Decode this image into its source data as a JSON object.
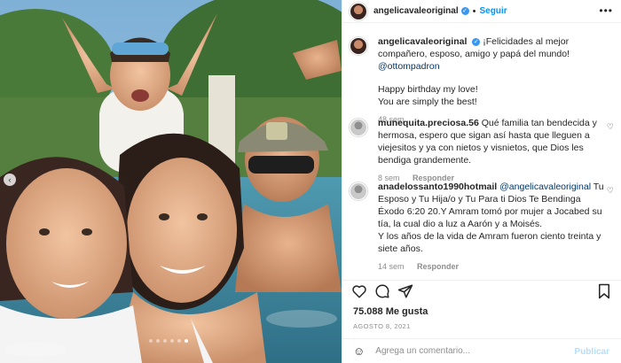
{
  "header": {
    "username": "angelicavaleoriginal",
    "separator": "•",
    "follow_label": "Seguir",
    "more_label": "•••"
  },
  "caption": {
    "username": "angelicavaleoriginal",
    "text": "¡Felicidades al mejor compañero, esposo, amigo y papá del mundo!",
    "mention": "@ottompadron",
    "line2": "Happy birthday my love!",
    "line3": "You are simply the best!",
    "time": "48 sem"
  },
  "comments": [
    {
      "username": "munequita.preciosa.56",
      "text": "Qué familia tan bendecida y hermosa, espero que sigan así hasta que lleguen a viejesitos y ya con nietos y visnietos, que Dios les bendiga grandemente.",
      "time": "8 sem",
      "reply": "Responder"
    },
    {
      "username": "anadelossanto1990hotmail",
      "mention": "@angelicavaleoriginal",
      "text": "Tu Esposo y Tu Hija/o y Tu Para ti Dios Te Bendinga Éxodo 6:20 20.Y Amram tomó por mujer a Jocabed su tía, la cual dio a luz a Aarón y a Moisés.",
      "text2": "Y los años de la vida de Amram fueron ciento treinta y siete años.",
      "time": "14 sem",
      "reply": "Responder"
    }
  ],
  "likes": "75.088 Me gusta",
  "date": "AGOSTO 8, 2021",
  "composer": {
    "placeholder": "Agrega un comentario...",
    "publish_label": "Publicar"
  },
  "icons": {
    "heart": "heart-icon",
    "comment": "comment-icon",
    "share": "share-icon",
    "save": "bookmark-icon",
    "emoji": "emoji-icon",
    "verified": "verified-badge-icon"
  },
  "colors": {
    "accent": "#0095f6",
    "verified": "#3897f0",
    "publish_disabled": "#b2dffc"
  }
}
